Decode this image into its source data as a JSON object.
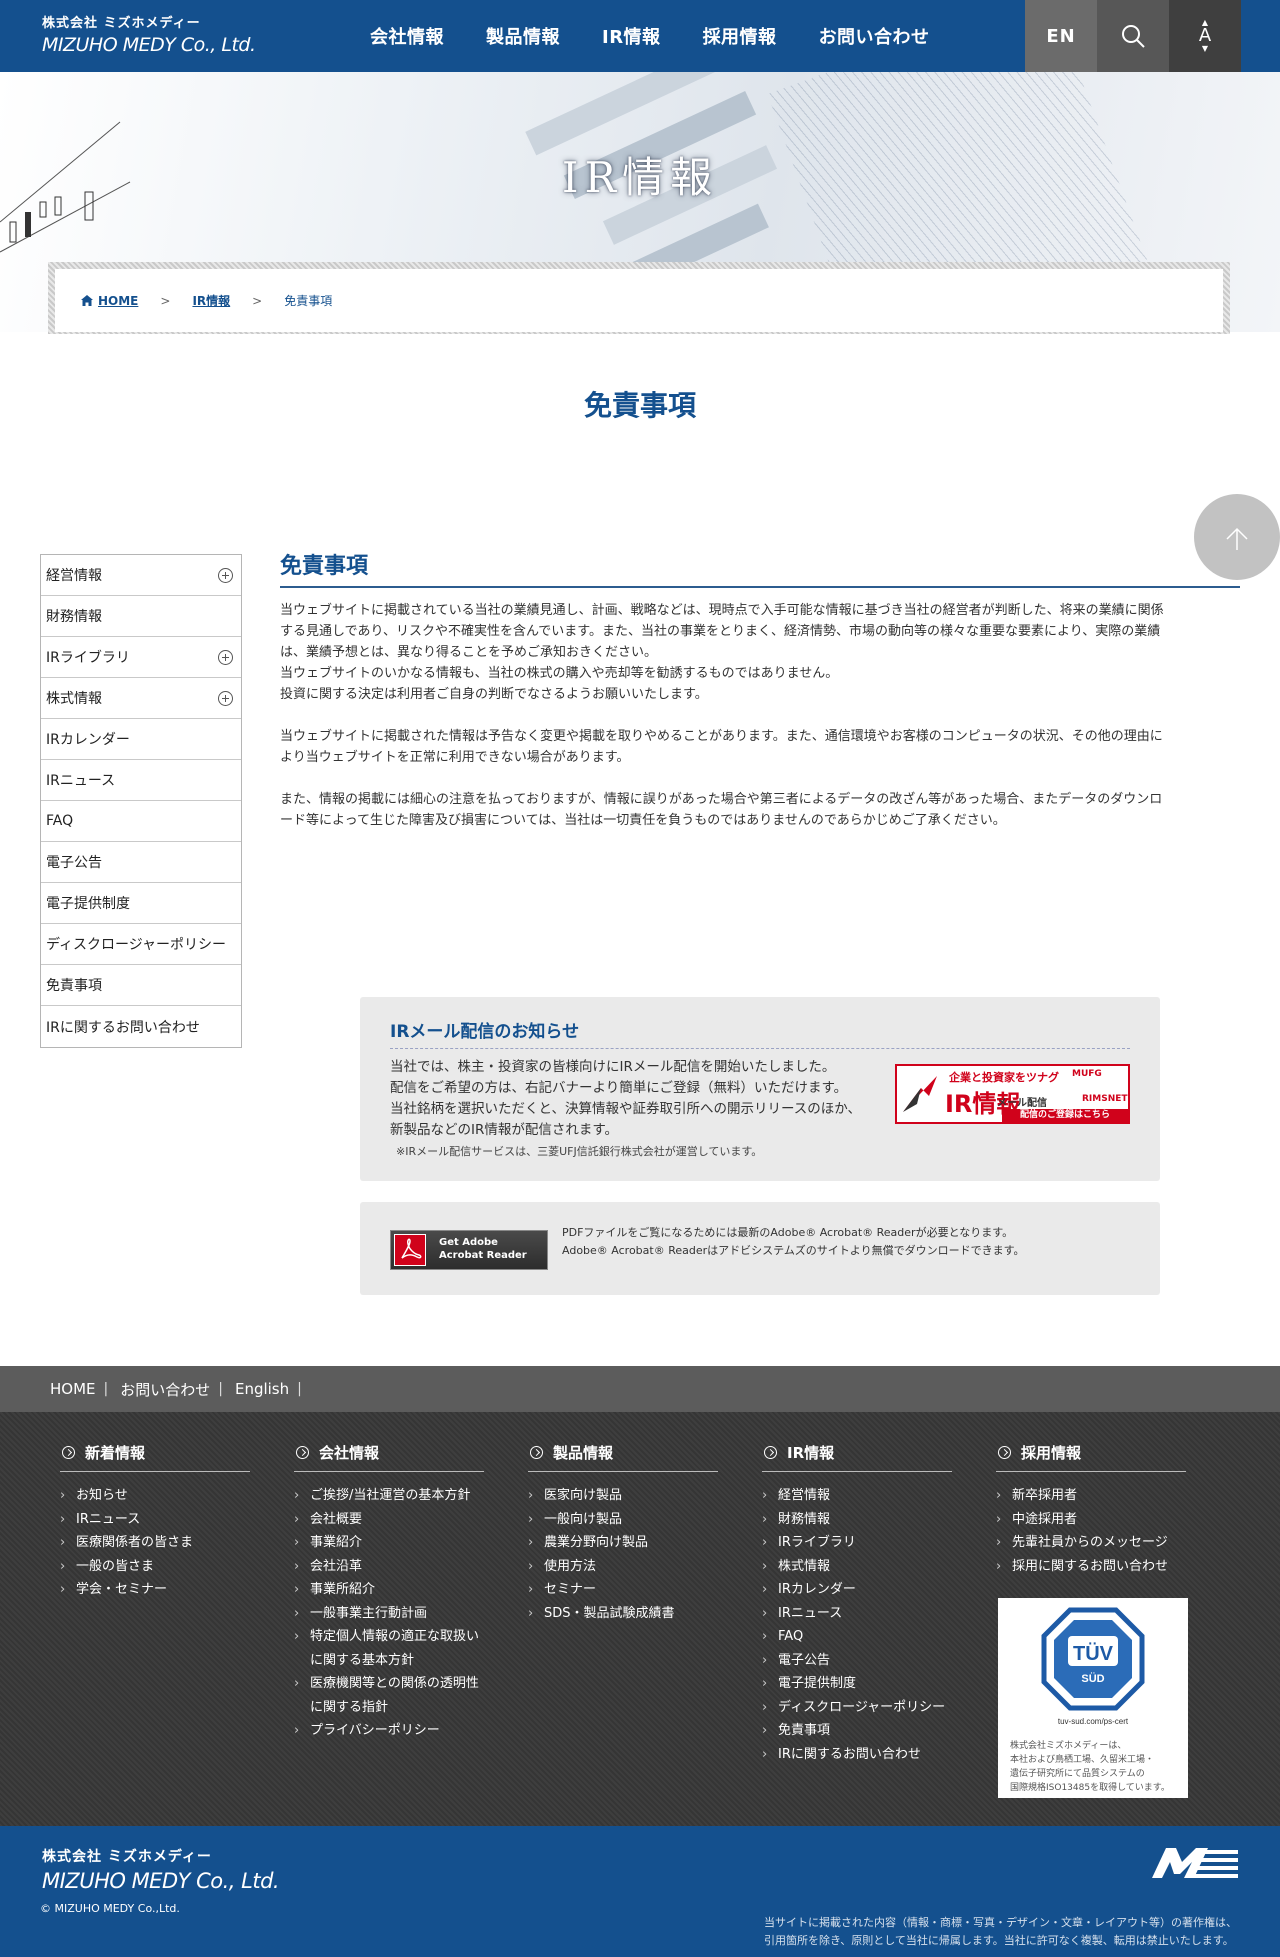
{
  "header": {
    "logo_jp": "株式会社 ミズホメディー",
    "logo_en": "MIZUHO MEDY Co., Ltd.",
    "nav": [
      "会社情報",
      "製品情報",
      "IR情報",
      "採用情報",
      "お問い合わせ"
    ],
    "lang_label": "EN",
    "font_label": "A"
  },
  "hero": {
    "title": "IR情報"
  },
  "breadcrumb": {
    "home": "HOME",
    "sep": ">",
    "parent": "IR情報",
    "current": "免責事項"
  },
  "page": {
    "title": "免責事項"
  },
  "sidenav": {
    "items": [
      {
        "label": "経営情報"
      },
      {
        "label": "財務情報"
      },
      {
        "label": "IRライブラリ"
      },
      {
        "label": "株式情報"
      },
      {
        "label": "IRカレンダー"
      },
      {
        "label": "IRニュース"
      },
      {
        "label": "FAQ"
      },
      {
        "label": "電子公告"
      },
      {
        "label": "電子提供制度"
      },
      {
        "label": "ディスクロージャーポリシー"
      },
      {
        "label": "免責事項"
      },
      {
        "label": "IRに関するお問い合わせ"
      }
    ]
  },
  "content": {
    "heading": "免責事項",
    "p1_l1": "当ウェブサイトに掲載されている当社の業績見通し、計画、戦略などは、現時点で入手可能な情報に基づき当社の経営者が判断した、将来の業績に関係",
    "p1_l2": "する見通しであり、リスクや不確実性を含んでいます。また、当社の事業をとりまく、経済情勢、市場の動向等の様々な重要な要素により、実際の業績",
    "p1_l3": "は、業績予想とは、異なり得ることを予めご承知おきください。",
    "p1_l4": "当ウェブサイトのいかなる情報も、当社の株式の購入や売却等を勧誘するものではありません。",
    "p1_l5": "投資に関する決定は利用者ご自身の判断でなさるようお願いいたします。",
    "p2_l1": "当ウェブサイトに掲載された情報は予告なく変更や掲載を取りやめることがあります。また、通信環境やお客様のコンピュータの状況、その他の理由に",
    "p2_l2": "より当ウェブサイトを正常に利用できない場合があります。",
    "p3_l1": "また、情報の掲載には細心の注意を払っておりますが、情報に誤りがあった場合や第三者によるデータの改ざん等があった場合、またデータのダウンロ",
    "p3_l2": "ード等によって生じた障害及び損害については、当社は一切責任を負うものではありませんのであらかじめご了承ください。"
  },
  "irmail": {
    "title": "IRメール配信のお知らせ",
    "line1": "当社では、株主・投資家の皆様向けにIRメール配信を開始いたしました。",
    "line2": "配信をご希望の方は、右記バナーより簡単にご登録（無料）いただけます。",
    "line3": "当社銘柄を選択いただくと、決算情報や証券取引所への開示リリースのほか、",
    "line4": "新製品などのIR情報が配信されます。",
    "note": "※IRメール配信サービスは、三菱UFJ信託銀行株式会社が運営しています。",
    "banner_line1": "企業と投資家をツナグ",
    "banner_ir": "IR情報",
    "banner_mail": "メール配信",
    "banner_mufg": "MUFG",
    "banner_rims": "RIMSNET",
    "banner_cta": "配信のご登録はこちら"
  },
  "adobe": {
    "btn_line1": "Get Adobe",
    "btn_line2": "Acrobat Reader",
    "text1": "PDFファイルをご覧になるためには最新のAdobe® Acrobat® Readerが必要となります。",
    "text2": "Adobe® Acrobat® Readerはアドビシステムズのサイトより無償でダウンロードできます。"
  },
  "footer_bar": {
    "links": [
      "HOME",
      "お問い合わせ",
      "English"
    ],
    "sep": "|"
  },
  "sitemap": {
    "col1": {
      "head": "新着情報",
      "items": [
        "お知らせ",
        "IRニュース",
        "医療関係者の皆さま",
        "一般の皆さま",
        "学会・セミナー"
      ]
    },
    "col2": {
      "head": "会社情報",
      "items": [
        "ご挨拶/当社運営の基本方針",
        "会社概要",
        "事業紹介",
        "会社沿革",
        "事業所紹介",
        "一般事業主行動計画",
        "特定個人情報の適正な取扱い",
        "に関する基本方針",
        "医療機関等との関係の透明性",
        "に関する指針",
        "プライバシーポリシー"
      ]
    },
    "col3": {
      "head": "製品情報",
      "items": [
        "医家向け製品",
        "一般向け製品",
        "農業分野向け製品",
        "使用方法",
        "セミナー",
        "SDS・製品試験成績書"
      ]
    },
    "col4": {
      "head": "IR情報",
      "items": [
        "経営情報",
        "財務情報",
        "IRライブラリ",
        "株式情報",
        "IRカレンダー",
        "IRニュース",
        "FAQ",
        "電子公告",
        "電子提供制度",
        "ディスクロージャーポリシー",
        "免責事項",
        "IRに関するお問い合わせ"
      ]
    },
    "col5": {
      "head": "採用情報",
      "items": [
        "新卒採用者",
        "中途採用者",
        "先輩社員からのメッセージ",
        "採用に関するお問い合わせ"
      ]
    },
    "tuv": {
      "mark": "TÜV",
      "sub": "SÜD",
      "url": "tuv-sud.com/ps-cert",
      "cap1": "株式会社ミズホメディーは、",
      "cap2": "本社および鳥栖工場、久留米工場・",
      "cap3": "遺伝子研究所にて品質システムの",
      "cap4": "国際規格ISO13485を取得しています。"
    }
  },
  "footer": {
    "logo_jp": "株式会社 ミズホメディー",
    "logo_en": "MIZUHO MEDY Co., Ltd.",
    "copyright": "© MIZUHO MEDY Co.,Ltd.",
    "notice1": "当サイトに掲載された内容（情報・商標・写真・デザイン・文章・レイアウト等）の著作権は、",
    "notice2": "引用箇所を除き、原則として当社に帰属します。当社に許可なく複製、転用は禁止いたします。"
  },
  "colors": {
    "brand": "#14508e",
    "accent_red": "#d0021b"
  }
}
